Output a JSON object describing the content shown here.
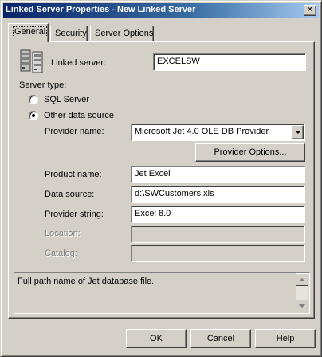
{
  "window": {
    "title": "Linked Server Properties - New Linked Server",
    "close_glyph": "✕"
  },
  "tabs": [
    {
      "label": "General",
      "active": true
    },
    {
      "label": "Security",
      "active": false
    },
    {
      "label": "Server Options",
      "active": false
    }
  ],
  "general": {
    "linked_server_label": "Linked server:",
    "linked_server_value": "EXCELSW",
    "server_type_label": "Server type:",
    "sql_server_label": "SQL Server",
    "other_source_label": "Other data source",
    "selected_server_type": "Other data source",
    "provider_name_label": "Provider name:",
    "provider_name_value": "Microsoft Jet 4.0 OLE DB Provider",
    "provider_options_label": "Provider Options...",
    "product_name_label": "Product name:",
    "product_name_value": "Jet Excel",
    "data_source_label": "Data source:",
    "data_source_value": "d:\\SWCustomers.xls",
    "provider_string_label": "Provider string:",
    "provider_string_value": "Excel 8.0",
    "location_label": "Location:",
    "location_value": "",
    "catalog_label": "Catalog:",
    "catalog_value": "",
    "description_text": "Full path name of Jet database file."
  },
  "buttons": {
    "ok": "OK",
    "cancel": "Cancel",
    "help": "Help"
  },
  "colors": {
    "face": "#d4d0c8",
    "title_start": "#0a246a",
    "title_end": "#a6caf0",
    "disabled_text": "#808080"
  },
  "icons": {
    "server": "server-stack-icon",
    "dropdown": "chevron-down-icon"
  }
}
